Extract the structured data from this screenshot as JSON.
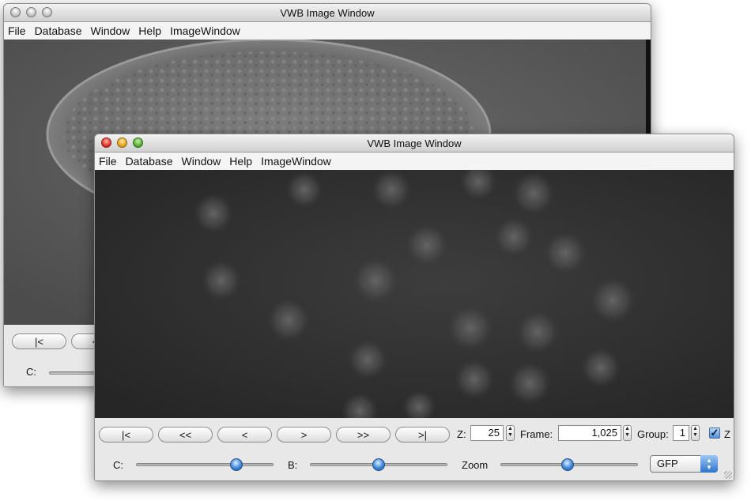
{
  "back_window": {
    "title": "VWB Image Window",
    "menu": [
      "File",
      "Database",
      "Window",
      "Help",
      "ImageWindow"
    ],
    "buttons": {
      "first": "|<",
      "prev_fast": "<<"
    },
    "c_label": "C:"
  },
  "front_window": {
    "title": "VWB Image Window",
    "menu": [
      "File",
      "Database",
      "Window",
      "Help",
      "ImageWindow"
    ],
    "nav": {
      "first": "|<",
      "rewind": "<<",
      "prev": "<",
      "next": ">",
      "forward": ">>",
      "last": ">|"
    },
    "z": {
      "label": "Z:",
      "value": "25"
    },
    "frame": {
      "label": "Frame:",
      "value": "1,025"
    },
    "group": {
      "label": "Group:",
      "value": "1"
    },
    "z_checkbox": {
      "label": "Z",
      "checked": true
    },
    "c_slider": {
      "label": "C:",
      "level": 0.73
    },
    "b_slider": {
      "label": "B:",
      "level": 0.5
    },
    "zoom_slider": {
      "label": "Zoom",
      "level": 0.49
    },
    "channel": {
      "selected": "GFP"
    }
  }
}
